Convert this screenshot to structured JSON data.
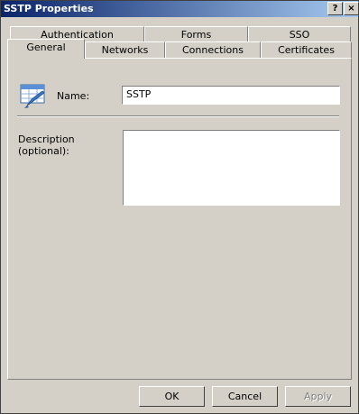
{
  "window": {
    "title": "SSTP Properties",
    "help_glyph": "?",
    "close_glyph": "×"
  },
  "tabs_back": [
    "Authentication",
    "Forms",
    "SSO"
  ],
  "tabs_front": [
    "General",
    "Networks",
    "Connections",
    "Certificates"
  ],
  "active_tab": "General",
  "general": {
    "name_label": "Name:",
    "name_value": "SSTP",
    "description_label_line1": "Description",
    "description_label_line2": "(optional):",
    "description_value": ""
  },
  "buttons": {
    "ok": "OK",
    "cancel": "Cancel",
    "apply": "Apply"
  },
  "colors": {
    "titlebar_start": "#0a246a",
    "titlebar_end": "#a6caf0",
    "face": "#d4d0c8"
  },
  "icons": {
    "rule_icon": "rule-properties-icon"
  }
}
